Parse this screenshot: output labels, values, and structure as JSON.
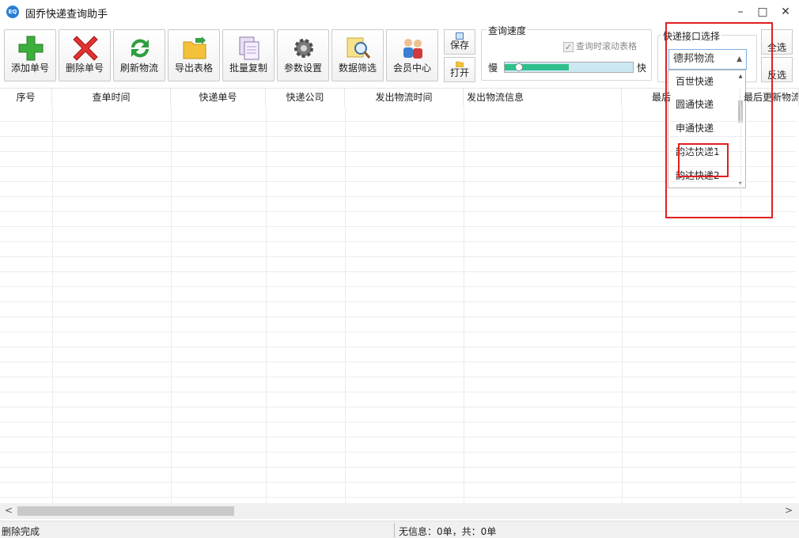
{
  "window": {
    "title": "固乔快递查询助手",
    "minimize": "–",
    "maximize": "□",
    "close": "✕"
  },
  "toolbar": {
    "add": "添加单号",
    "delete": "删除单号",
    "refresh": "刷新物流",
    "export": "导出表格",
    "batch_copy": "批量复制",
    "settings": "参数设置",
    "filter": "数据筛选",
    "member": "会员中心",
    "save": "保存",
    "open": "打开"
  },
  "speed": {
    "group_label": "查询速度",
    "scroll_label": "查询时滚动表格",
    "scroll_checked": true,
    "slow": "慢",
    "fast": "快",
    "level_fraction": 0.08
  },
  "api": {
    "group_label": "快递接口选择",
    "selected": "德邦物流",
    "options": [
      "百世快递",
      "圆通快递",
      "申通快递",
      "韵达快递1",
      "韵达快递2"
    ]
  },
  "right_buttons": {
    "select_all": "全选",
    "invert": "反选"
  },
  "table": {
    "columns": [
      "序号",
      "查单时间",
      "快递单号",
      "快递公司",
      "发出物流时间",
      "发出物流信息",
      "最后",
      "最后更新物流"
    ]
  },
  "status": {
    "left": "删除完成",
    "right": "无信息：0单，共：0单"
  },
  "colors": {
    "accent": "#2a7fd4",
    "highlight": "#e02020",
    "speed_fill": "#2fbf8d"
  }
}
